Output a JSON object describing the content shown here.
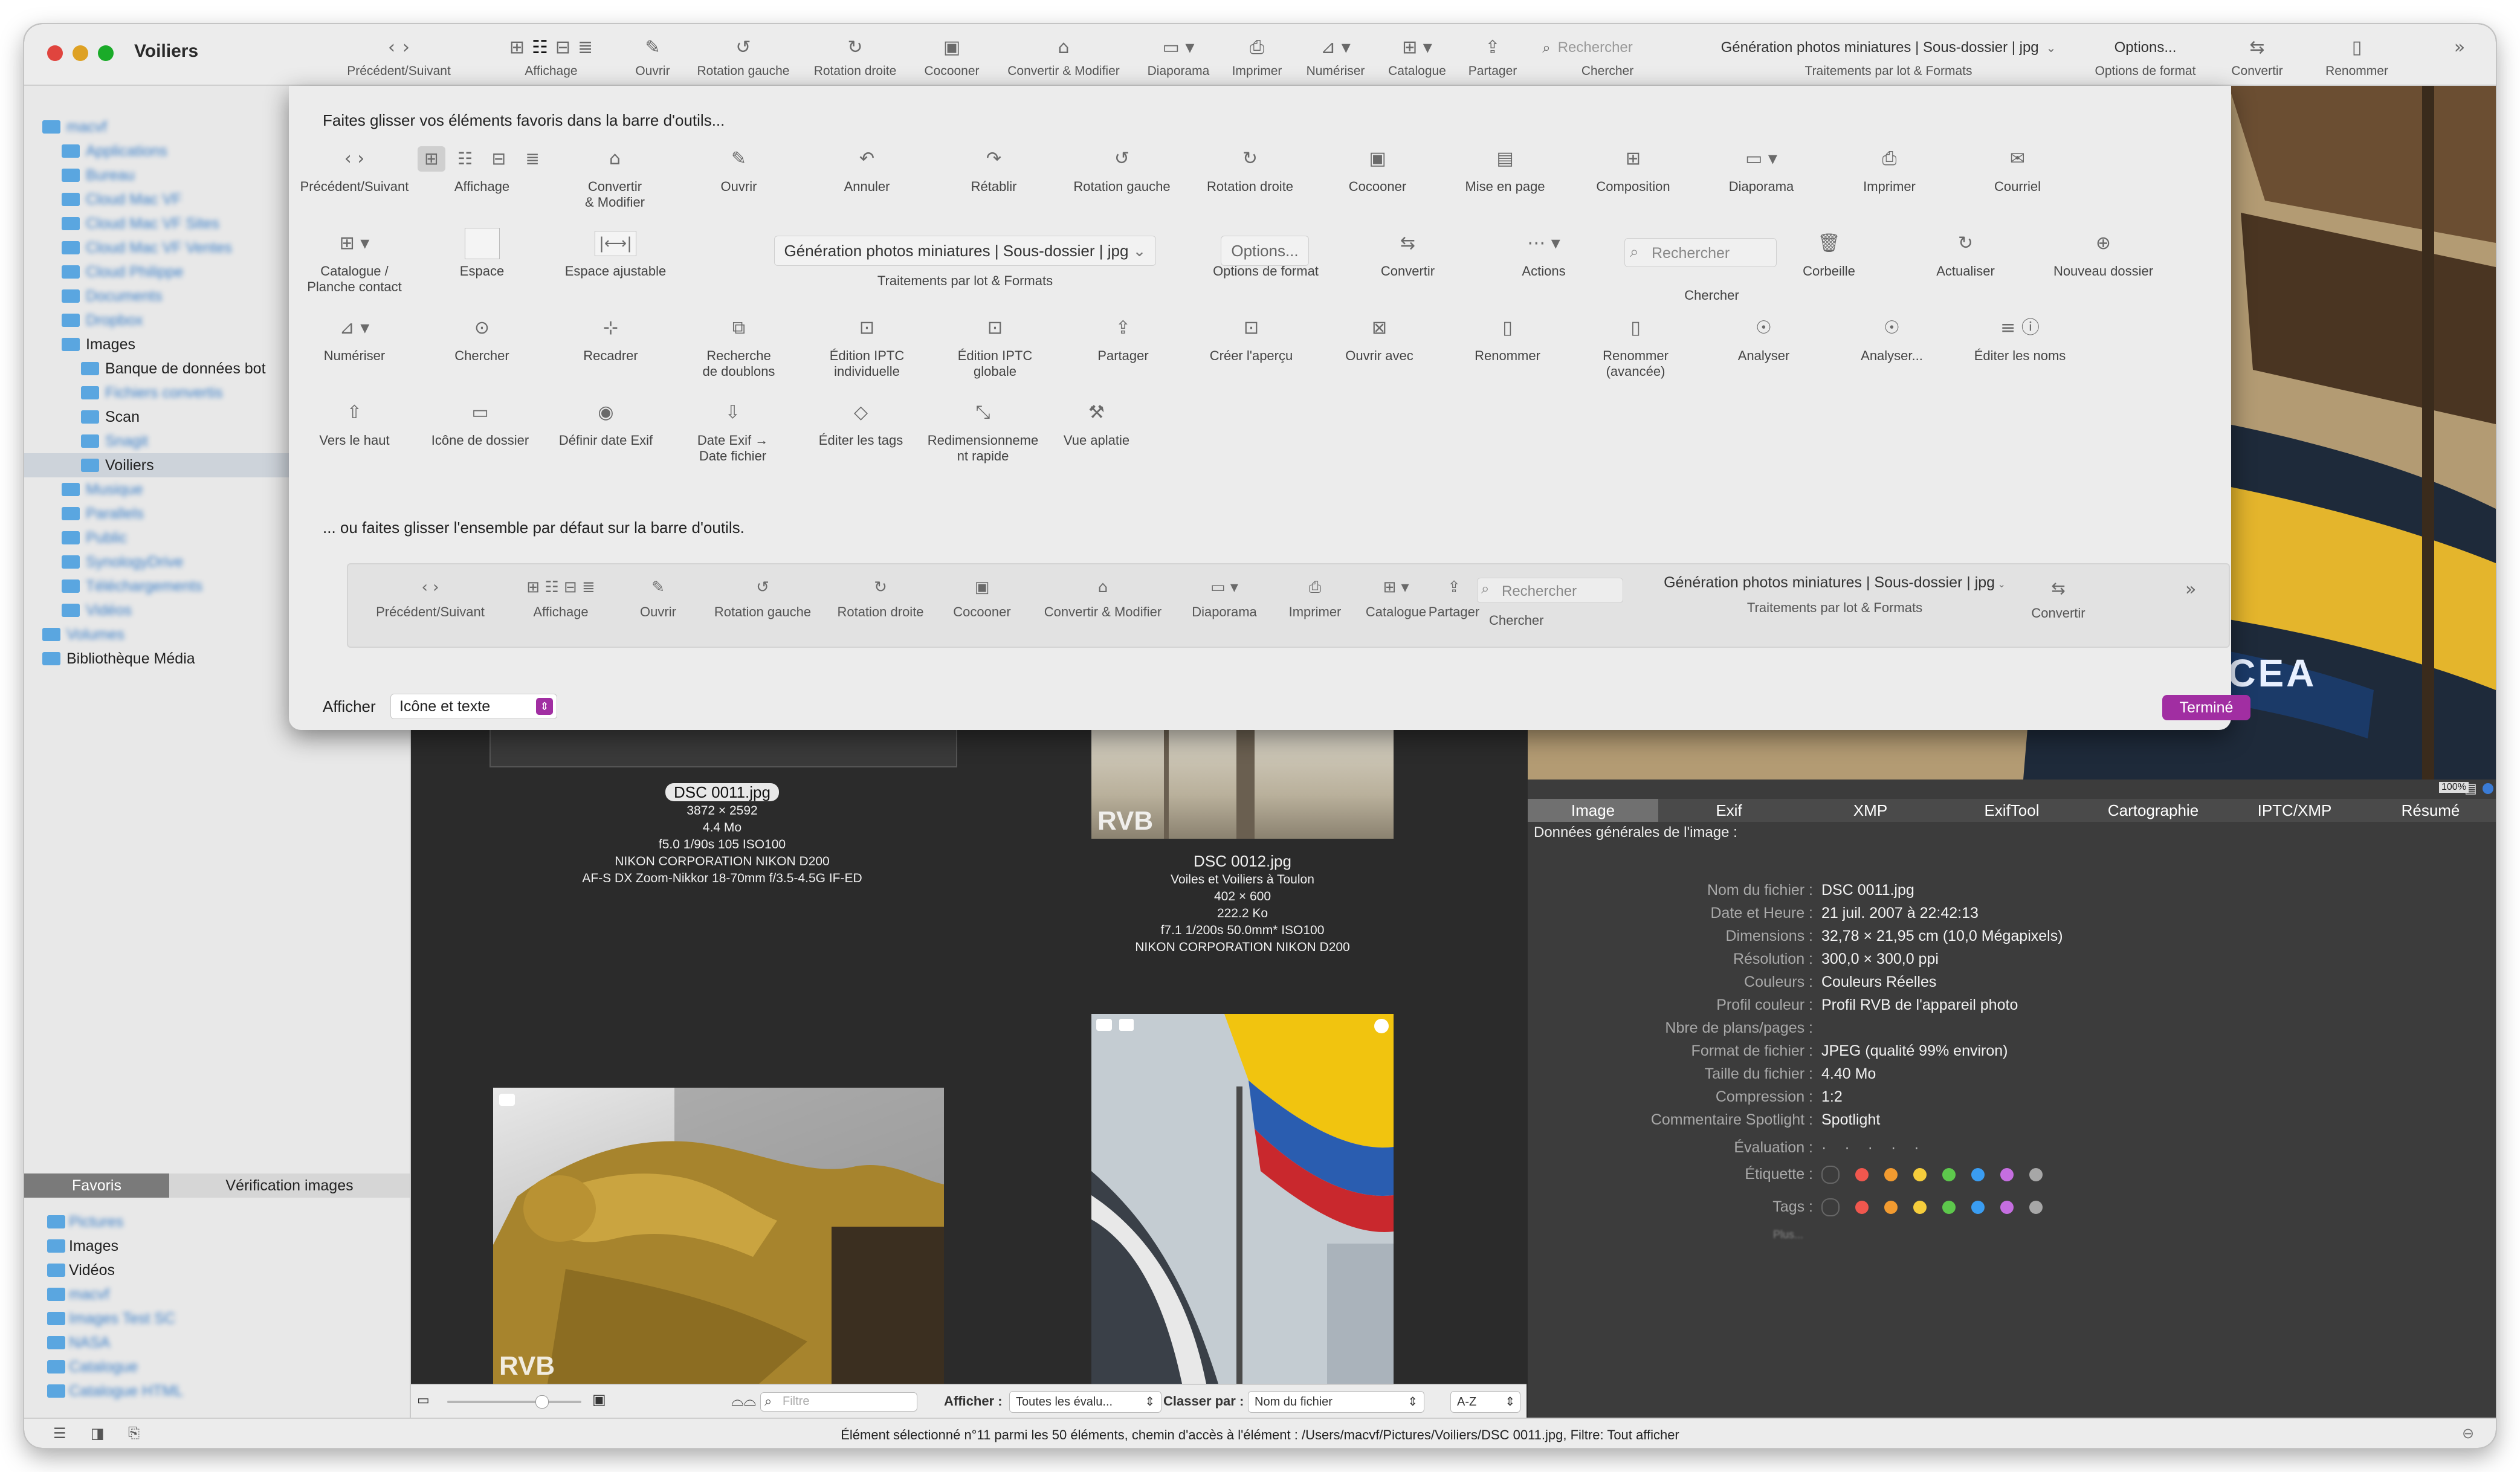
{
  "window": {
    "title": "Voiliers"
  },
  "colors": {
    "accent": "#a12ea2",
    "folder": "#5aa6e0",
    "close": "#e0443e",
    "minimize": "#dea123",
    "zoom": "#1aab29"
  },
  "toolbar": {
    "items": [
      {
        "name": "prev-next",
        "label": "Précédent/Suivant"
      },
      {
        "name": "view",
        "label": "Affichage"
      },
      {
        "name": "open",
        "label": "Ouvrir"
      },
      {
        "name": "rotate-left",
        "label": "Rotation gauche"
      },
      {
        "name": "rotate-right",
        "label": "Rotation droite"
      },
      {
        "name": "cocoon",
        "label": "Cocooner"
      },
      {
        "name": "convert-modify",
        "label": "Convertir & Modifier"
      },
      {
        "name": "slideshow",
        "label": "Diaporama"
      },
      {
        "name": "print",
        "label": "Imprimer"
      },
      {
        "name": "scan",
        "label": "Numériser"
      },
      {
        "name": "catalog",
        "label": "Catalogue"
      },
      {
        "name": "share",
        "label": "Partager"
      }
    ],
    "search_placeholder": "Rechercher",
    "search_label": "Chercher",
    "batch_value": "Génération photos miniatures | Sous-dossier | jpg",
    "batch_label": "Traitements par lot & Formats",
    "options_value": "Options...",
    "options_label": "Options de format",
    "convert_label": "Convertir",
    "rename_label": "Renommer"
  },
  "sidebar": {
    "tree": [
      {
        "label": "macvf",
        "depth": 0,
        "blurred": true
      },
      {
        "label": "Applications",
        "depth": 1,
        "blurred": true
      },
      {
        "label": "Bureau",
        "depth": 1,
        "blurred": true
      },
      {
        "label": "Cloud Mac VF",
        "depth": 1,
        "blurred": true
      },
      {
        "label": "Cloud Mac VF Sites",
        "depth": 1,
        "blurred": true
      },
      {
        "label": "Cloud Mac VF Ventes",
        "depth": 1,
        "blurred": true
      },
      {
        "label": "Cloud Philippe",
        "depth": 1,
        "blurred": true
      },
      {
        "label": "Documents",
        "depth": 1,
        "blurred": true
      },
      {
        "label": "Dropbox",
        "depth": 1,
        "blurred": true
      },
      {
        "label": "Images",
        "depth": 1,
        "blurred": false
      },
      {
        "label": "Banque de données bot",
        "depth": 2,
        "blurred": false
      },
      {
        "label": "Fichiers convertis",
        "depth": 2,
        "blurred": true
      },
      {
        "label": "Scan",
        "depth": 2,
        "blurred": false
      },
      {
        "label": "Snagit",
        "depth": 2,
        "blurred": true
      },
      {
        "label": "Voiliers",
        "depth": 2,
        "blurred": false,
        "selected": true
      },
      {
        "label": "Musique",
        "depth": 1,
        "blurred": true
      },
      {
        "label": "Parallels",
        "depth": 1,
        "blurred": true
      },
      {
        "label": "Public",
        "depth": 1,
        "blurred": true
      },
      {
        "label": "SynologyDrive",
        "depth": 1,
        "blurred": true
      },
      {
        "label": "Téléchargements",
        "depth": 1,
        "blurred": true
      },
      {
        "label": "Vidéos",
        "depth": 1,
        "blurred": true
      },
      {
        "label": "Volumes",
        "depth": 0,
        "blurred": true
      },
      {
        "label": "Bibliothèque Média",
        "depth": 0,
        "blurred": false
      }
    ],
    "tabs": [
      "Favoris",
      "Vérification images"
    ],
    "favorites": [
      {
        "label": "Pictures",
        "blurred": true
      },
      {
        "label": "Images",
        "blurred": false
      },
      {
        "label": "Vidéos",
        "blurred": false
      },
      {
        "label": "macvf",
        "blurred": true
      },
      {
        "label": "Images Test SC",
        "blurred": true
      },
      {
        "label": "NASA",
        "blurred": true
      },
      {
        "label": "Catalogue",
        "blurred": true
      },
      {
        "label": "Catalogue HTML",
        "blurred": true
      }
    ]
  },
  "sheet": {
    "heading": "Faites glisser vos éléments favoris dans la barre d'outils...",
    "row1": [
      {
        "label": "Précédent/Suivant",
        "icon": "nav"
      },
      {
        "label": "Affichage",
        "icon": "view"
      },
      {
        "label": "Convertir\n& Modifier",
        "icon": "convert"
      },
      {
        "label": "Ouvrir",
        "icon": "open"
      },
      {
        "label": "Annuler",
        "icon": "undo"
      },
      {
        "label": "Rétablir",
        "icon": "redo"
      },
      {
        "label": "Rotation gauche",
        "icon": "rotl"
      },
      {
        "label": "Rotation droite",
        "icon": "rotr"
      },
      {
        "label": "Cocooner",
        "icon": "cocoon"
      },
      {
        "label": "Mise en page",
        "icon": "layout"
      },
      {
        "label": "Composition",
        "icon": "compo"
      },
      {
        "label": "Diaporama",
        "icon": "slide"
      },
      {
        "label": "Imprimer",
        "icon": "print"
      },
      {
        "label": "Courriel",
        "icon": "mail"
      }
    ],
    "row2": [
      {
        "label": "Catalogue /\nPlanche contact",
        "icon": "catalog"
      },
      {
        "label": "Espace",
        "icon": "space"
      },
      {
        "label": "Espace ajustable",
        "icon": "flexspace"
      },
      {
        "label": "Options de format",
        "icon": "options"
      },
      {
        "label": "Convertir",
        "icon": "convert2"
      },
      {
        "label": "Actions",
        "icon": "actions"
      },
      {
        "label": "Chercher",
        "icon": "search"
      },
      {
        "label": "Corbeille",
        "icon": "trash"
      },
      {
        "label": "Actualiser",
        "icon": "refresh"
      },
      {
        "label": "Nouveau dossier",
        "icon": "newfolder"
      }
    ],
    "batch_value": "Génération photos miniatures | Sous-dossier | jpg",
    "batch_label": "Traitements par lot & Formats",
    "options_value": "Options...",
    "search_placeholder": "Rechercher",
    "row3": [
      {
        "label": "Numériser",
        "icon": "scan"
      },
      {
        "label": "Chercher",
        "icon": "find"
      },
      {
        "label": "Recadrer",
        "icon": "crop"
      },
      {
        "label": "Recherche\nde doublons",
        "icon": "dupes"
      },
      {
        "label": "Édition IPTC\nindividuelle",
        "icon": "iptc1"
      },
      {
        "label": "Édition IPTC\nglobale",
        "icon": "iptc2"
      },
      {
        "label": "Partager",
        "icon": "share"
      },
      {
        "label": "Créer l'aperçu",
        "icon": "preview"
      },
      {
        "label": "Ouvrir avec",
        "icon": "openwith"
      },
      {
        "label": "Renommer",
        "icon": "rename"
      },
      {
        "label": "Renommer\n(avancée)",
        "icon": "rename2"
      },
      {
        "label": "Analyser",
        "icon": "bulb"
      },
      {
        "label": "Analyser...",
        "icon": "bulb2"
      },
      {
        "label": "Éditer les noms",
        "icon": "names"
      }
    ],
    "row4": [
      {
        "label": "Vers le haut",
        "icon": "up"
      },
      {
        "label": "Icône de dossier",
        "icon": "foldericon"
      },
      {
        "label": "Définir date Exif",
        "icon": "camera"
      },
      {
        "label": "Date Exif →\nDate fichier",
        "icon": "download"
      },
      {
        "label": "Éditer les tags",
        "icon": "tag"
      },
      {
        "label": "Redimensionneme\nnt rapide",
        "icon": "resize"
      },
      {
        "label": "Vue aplatie",
        "icon": "flatten"
      }
    ],
    "default_heading": "... ou faites glisser l'ensemble par défaut sur la barre d'outils.",
    "default_items": [
      "Précédent/Suivant",
      "Affichage",
      "Ouvrir",
      "Rotation gauche",
      "Rotation droite",
      "Cocooner",
      "Convertir & Modifier",
      "Diaporama",
      "Imprimer",
      "Catalogue",
      "Partager"
    ],
    "default_search_label": "Chercher",
    "default_convert_label": "Convertir",
    "show_label": "Afficher",
    "show_value": "Icône et texte",
    "done_label": "Terminé"
  },
  "thumbs": [
    {
      "file": "DSC 0011.jpg",
      "lines": [
        "3872 × 2592",
        "4.4  Mo",
        "f5.0 1/90s 105 ISO100",
        "NIKON CORPORATION NIKON D200",
        "AF-S DX Zoom-Nikkor 18-70mm f/3.5-4.5G IF-ED"
      ],
      "badge": "RVB",
      "selected": true
    },
    {
      "file": "DSC 0012.jpg",
      "lines": [
        "Voiles et Voiliers à Toulon",
        "402 × 600",
        "222.2 Ko",
        "f7.1 1/200s 50.0mm* ISO100",
        "NIKON CORPORATION NIKON D200"
      ],
      "badge": "RVB",
      "selected": false
    },
    {
      "badge": "RVB"
    }
  ],
  "content_bar": {
    "filter_placeholder": "Filtre",
    "show_label": "Afficher :",
    "show_value": "Toutes les évalu...",
    "sort_label": "Classer par :",
    "sort_value": "Nom du fichier",
    "order_value": "A-Z"
  },
  "preview": {
    "overlay_text": "RCEA",
    "zoom_value": "100%"
  },
  "info": {
    "tabs": [
      "Image",
      "Exif",
      "XMP",
      "ExifTool",
      "Cartographie",
      "IPTC/XMP",
      "Résumé"
    ],
    "section": "Données générales de l'image :",
    "rows": [
      {
        "k": "Nom du fichier :",
        "v": "DSC 0011.jpg"
      },
      {
        "k": "Date et Heure :",
        "v": "21 juil. 2007 à 22:42:13"
      },
      {
        "k": "Dimensions :",
        "v": "32,78 × 21,95 cm (10,0 Mégapixels)"
      },
      {
        "k": "Résolution :",
        "v": "300,0 × 300,0 ppi"
      },
      {
        "k": "Couleurs :",
        "v": "Couleurs Réelles"
      },
      {
        "k": "Profil couleur :",
        "v": "Profil RVB de l'appareil photo"
      },
      {
        "k": "Nbre de plans/pages :",
        "v": ""
      },
      {
        "k": "Format de fichier :",
        "v": "JPEG (qualité 99% environ)"
      },
      {
        "k": "Taille du fichier :",
        "v": "4.40  Mo"
      },
      {
        "k": "Compression :",
        "v": "1:2"
      },
      {
        "k": "Commentaire Spotlight :",
        "v": "Spotlight"
      }
    ],
    "rating_label": "Évaluation :",
    "label_label": "Étiquette :",
    "tags_label": "Tags :",
    "more_label": "Plus...",
    "label_colors": [
      "#f0574e",
      "#f29b30",
      "#f5cd3c",
      "#5dc84c",
      "#3a9df2",
      "#c56ee0",
      "#a7a7a7"
    ]
  },
  "status": {
    "text": "Élément sélectionné n°11 parmi les 50 éléments, chemin d'accès à l'élément : /Users/macvf/Pictures/Voiliers/DSC 0011.jpg, Filtre: Tout afficher"
  }
}
